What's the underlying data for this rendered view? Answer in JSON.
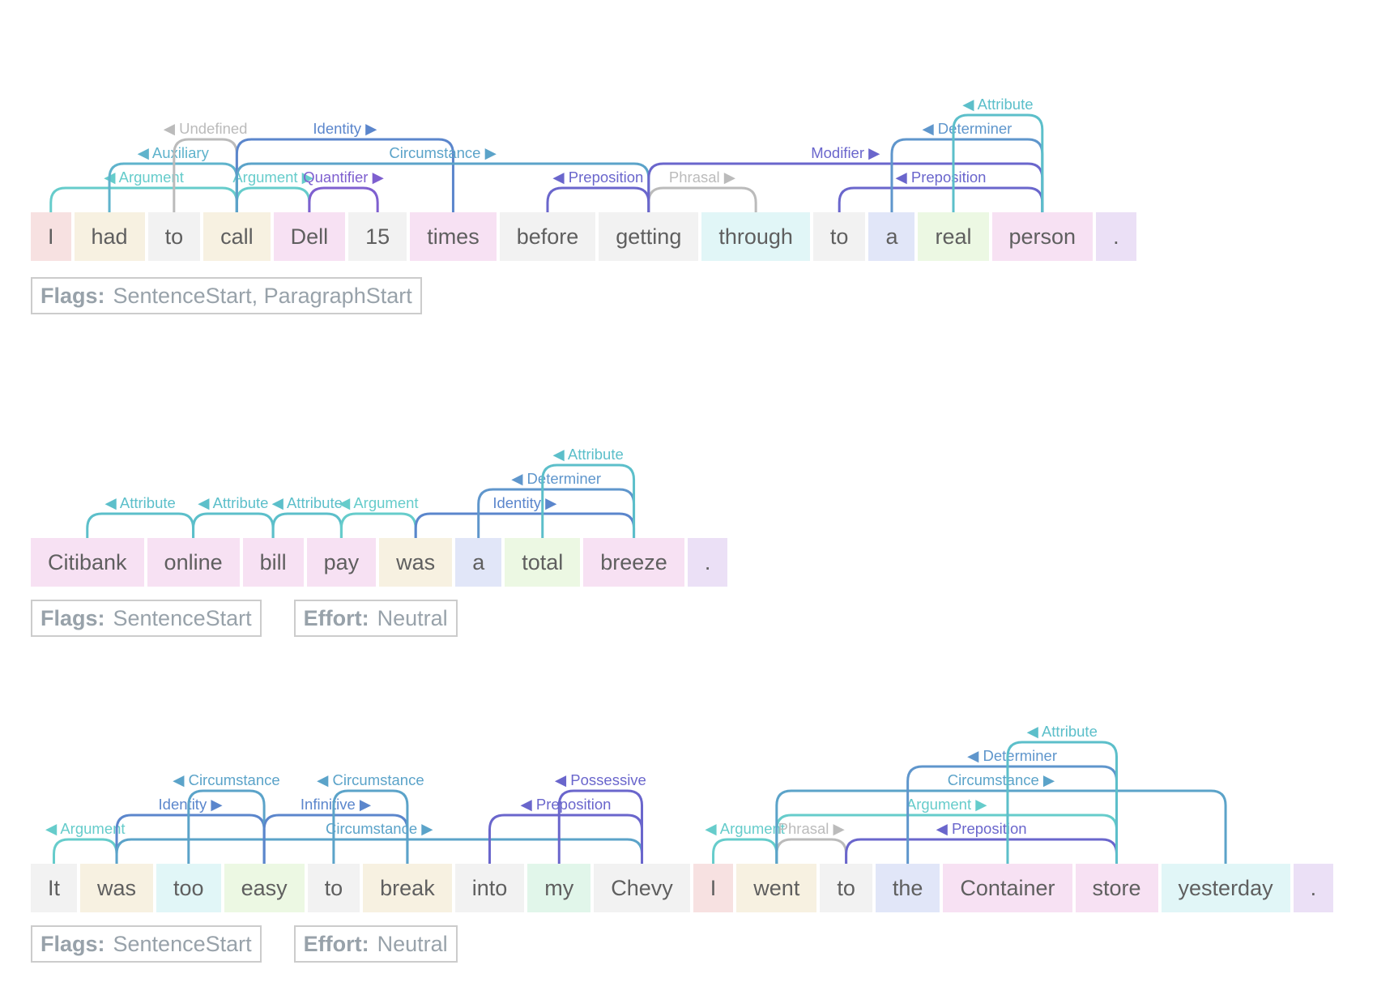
{
  "colors": {
    "token_bg": {
      "red": "#f7e1e1",
      "beige": "#f7f1e1",
      "gray": "#f2f2f2",
      "pink": "#f7e1f3",
      "cyan": "#e1f6f7",
      "blue": "#e1e6f8",
      "green": "#ecf8e3",
      "purple": "#ebe0f6",
      "mint": "#e1f6ea"
    },
    "arc": {
      "Argument": "#66cccb",
      "Auxiliary": "#5fb3cc",
      "Undefined": "#bbbbbb",
      "Identity": "#5b86cc",
      "Circumstance": "#5ba3c9",
      "Quantifier": "#7e5fcf",
      "Preposition": "#6a66cc",
      "Phrasal": "#bbbbbb",
      "Modifier": "#6a66cc",
      "Determiner": "#5f96cc",
      "Attribute": "#5cbfca",
      "Infinitive": "#5b86cc",
      "Possessive": "#6a66cc"
    }
  },
  "sentences": [
    {
      "tokens": [
        {
          "text": "I",
          "bg": "red"
        },
        {
          "text": "had",
          "bg": "beige"
        },
        {
          "text": "to",
          "bg": "gray"
        },
        {
          "text": "call",
          "bg": "beige"
        },
        {
          "text": "Dell",
          "bg": "pink"
        },
        {
          "text": "15",
          "bg": "gray"
        },
        {
          "text": "times",
          "bg": "pink"
        },
        {
          "text": "before",
          "bg": "gray"
        },
        {
          "text": "getting",
          "bg": "gray"
        },
        {
          "text": "through",
          "bg": "cyan"
        },
        {
          "text": "to",
          "bg": "gray"
        },
        {
          "text": "a",
          "bg": "blue"
        },
        {
          "text": "real",
          "bg": "green"
        },
        {
          "text": "person",
          "bg": "pink"
        },
        {
          "text": ".",
          "bg": "purple"
        }
      ],
      "arcs": [
        {
          "from": 0,
          "to": 3,
          "label": "Argument",
          "dir": "left",
          "level": 1
        },
        {
          "from": 1,
          "to": 3,
          "label": "Auxiliary",
          "dir": "left",
          "level": 2
        },
        {
          "from": 2,
          "to": 3,
          "label": "Undefined",
          "dir": "left",
          "level": 3
        },
        {
          "from": 3,
          "to": 4,
          "label": "Argument",
          "dir": "right",
          "level": 1
        },
        {
          "from": 4,
          "to": 5,
          "label": "Quantifier",
          "dir": "right",
          "level": 1
        },
        {
          "from": 3,
          "to": 6,
          "label": "Identity",
          "dir": "right",
          "level": 3
        },
        {
          "from": 3,
          "to": 8,
          "label": "Circumstance",
          "dir": "right",
          "level": 2
        },
        {
          "from": 7,
          "to": 8,
          "label": "Preposition",
          "dir": "left",
          "level": 1
        },
        {
          "from": 8,
          "to": 9,
          "label": "Phrasal",
          "dir": "right",
          "level": 1
        },
        {
          "from": 8,
          "to": 13,
          "label": "Modifier",
          "dir": "right",
          "level": 2
        },
        {
          "from": 10,
          "to": 13,
          "label": "Preposition",
          "dir": "left",
          "level": 1
        },
        {
          "from": 11,
          "to": 13,
          "label": "Determiner",
          "dir": "left",
          "level": 3
        },
        {
          "from": 12,
          "to": 13,
          "label": "Attribute",
          "dir": "left",
          "level": 4
        }
      ],
      "meta": [
        {
          "key": "Flags:",
          "value": "SentenceStart, ParagraphStart"
        }
      ]
    },
    {
      "tokens": [
        {
          "text": "Citibank",
          "bg": "pink"
        },
        {
          "text": "online",
          "bg": "pink"
        },
        {
          "text": "bill",
          "bg": "pink"
        },
        {
          "text": "pay",
          "bg": "pink"
        },
        {
          "text": "was",
          "bg": "beige"
        },
        {
          "text": "a",
          "bg": "blue"
        },
        {
          "text": "total",
          "bg": "green"
        },
        {
          "text": "breeze",
          "bg": "pink"
        },
        {
          "text": ".",
          "bg": "purple"
        }
      ],
      "arcs": [
        {
          "from": 0,
          "to": 1,
          "label": "Attribute",
          "dir": "left",
          "level": 1
        },
        {
          "from": 1,
          "to": 2,
          "label": "Attribute",
          "dir": "left",
          "level": 1
        },
        {
          "from": 2,
          "to": 3,
          "label": "Attribute",
          "dir": "left",
          "level": 1
        },
        {
          "from": 3,
          "to": 4,
          "label": "Argument",
          "dir": "left",
          "level": 1
        },
        {
          "from": 4,
          "to": 7,
          "label": "Identity",
          "dir": "right",
          "level": 1
        },
        {
          "from": 5,
          "to": 7,
          "label": "Determiner",
          "dir": "left",
          "level": 2
        },
        {
          "from": 6,
          "to": 7,
          "label": "Attribute",
          "dir": "left",
          "level": 3
        }
      ],
      "meta": [
        {
          "key": "Flags:",
          "value": "SentenceStart"
        },
        {
          "key": "Effort:",
          "value": "Neutral"
        }
      ]
    },
    {
      "tokens": [
        {
          "text": "It",
          "bg": "gray"
        },
        {
          "text": "was",
          "bg": "beige"
        },
        {
          "text": "too",
          "bg": "cyan"
        },
        {
          "text": "easy",
          "bg": "green"
        },
        {
          "text": "to",
          "bg": "gray"
        },
        {
          "text": "break",
          "bg": "beige"
        },
        {
          "text": "into",
          "bg": "gray"
        },
        {
          "text": "my",
          "bg": "mint"
        },
        {
          "text": "Chevy",
          "bg": "gray"
        },
        {
          "text": "I",
          "bg": "red"
        },
        {
          "text": "went",
          "bg": "beige"
        },
        {
          "text": "to",
          "bg": "gray"
        },
        {
          "text": "the",
          "bg": "blue"
        },
        {
          "text": "Container",
          "bg": "pink"
        },
        {
          "text": "store",
          "bg": "pink"
        },
        {
          "text": "yesterday",
          "bg": "cyan"
        },
        {
          "text": ".",
          "bg": "purple"
        }
      ],
      "arcs": [
        {
          "from": 0,
          "to": 1,
          "label": "Argument",
          "dir": "left",
          "level": 1
        },
        {
          "from": 1,
          "to": 3,
          "label": "Identity",
          "dir": "right",
          "level": 2
        },
        {
          "from": 2,
          "to": 3,
          "label": "Circumstance",
          "dir": "left",
          "level": 3
        },
        {
          "from": 1,
          "to": 8,
          "label": "Circumstance",
          "dir": "right",
          "level": 1
        },
        {
          "from": 3,
          "to": 5,
          "label": "Infinitive",
          "dir": "right",
          "level": 2
        },
        {
          "from": 4,
          "to": 5,
          "label": "Circumstance",
          "dir": "left",
          "level": 3
        },
        {
          "from": 6,
          "to": 8,
          "label": "Preposition",
          "dir": "left",
          "level": 2
        },
        {
          "from": 7,
          "to": 8,
          "label": "Possessive",
          "dir": "left",
          "level": 3
        },
        {
          "from": 9,
          "to": 10,
          "label": "Argument",
          "dir": "left",
          "level": 1
        },
        {
          "from": 10,
          "to": 11,
          "label": "Phrasal",
          "dir": "right",
          "level": 1
        },
        {
          "from": 11,
          "to": 14,
          "label": "Preposition",
          "dir": "left",
          "level": 1
        },
        {
          "from": 10,
          "to": 14,
          "label": "Argument",
          "dir": "right",
          "level": 2
        },
        {
          "from": 10,
          "to": 15,
          "label": "Circumstance",
          "dir": "right",
          "level": 3
        },
        {
          "from": 12,
          "to": 14,
          "label": "Determiner",
          "dir": "left",
          "level": 4
        },
        {
          "from": 13,
          "to": 14,
          "label": "Attribute",
          "dir": "left",
          "level": 5
        }
      ],
      "meta": [
        {
          "key": "Flags:",
          "value": "SentenceStart"
        },
        {
          "key": "Effort:",
          "value": "Neutral"
        }
      ]
    }
  ]
}
